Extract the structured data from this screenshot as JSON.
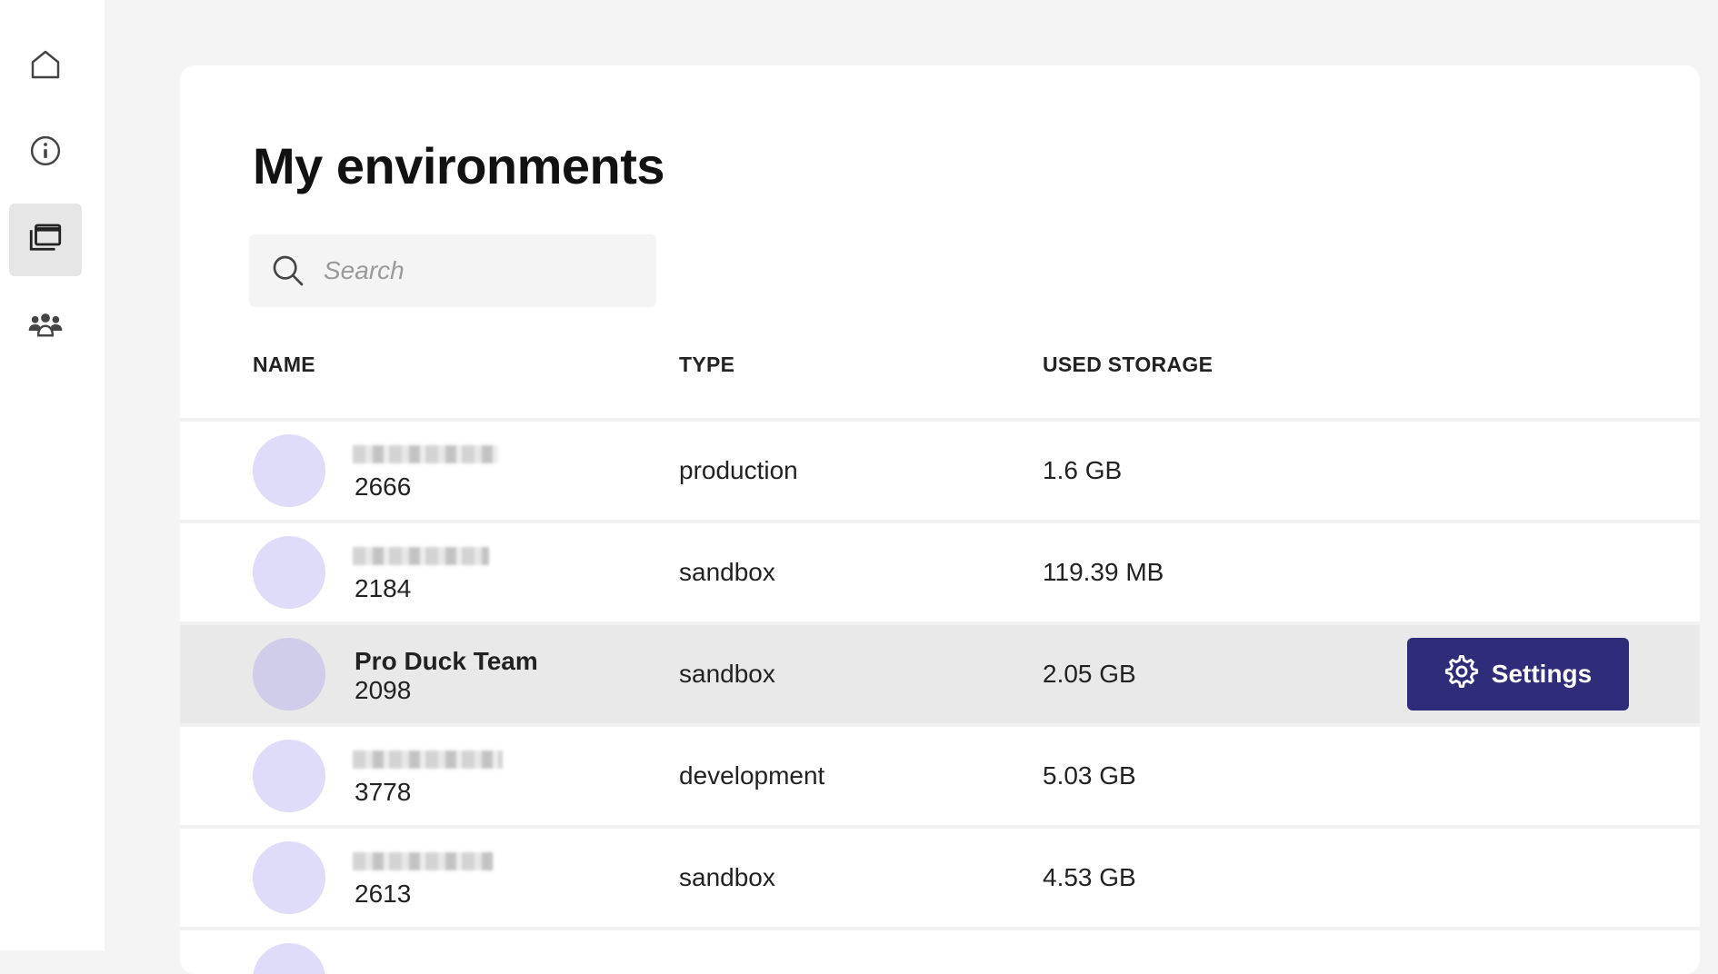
{
  "sidebar": {
    "items": [
      {
        "name": "home",
        "icon": "home-icon"
      },
      {
        "name": "info",
        "icon": "info-icon"
      },
      {
        "name": "environments",
        "icon": "environments-icon",
        "active": true
      },
      {
        "name": "team",
        "icon": "team-icon"
      }
    ]
  },
  "main": {
    "title": "My environments",
    "search": {
      "placeholder": "Search",
      "value": ""
    },
    "columns": [
      "NAME",
      "TYPE",
      "USED STORAGE"
    ],
    "rows": [
      {
        "name": "",
        "id": "2666",
        "type": "production",
        "storage": "1.6 GB"
      },
      {
        "name": "",
        "id": "2184",
        "type": "sandbox",
        "storage": "119.39 MB"
      },
      {
        "name": "Pro Duck Team",
        "id": "2098",
        "type": "sandbox",
        "storage": "2.05 GB",
        "highlighted": true
      },
      {
        "name": "",
        "id": "3778",
        "type": "development",
        "storage": "5.03 GB"
      },
      {
        "name": "",
        "id": "2613",
        "type": "sandbox",
        "storage": "4.53 GB"
      }
    ],
    "settings_label": "Settings"
  },
  "colors": {
    "accent": "#2f2d7a",
    "avatar": "#dedcf8",
    "highlight_row": "#e9e9e9",
    "background": "#f4f4f4"
  }
}
